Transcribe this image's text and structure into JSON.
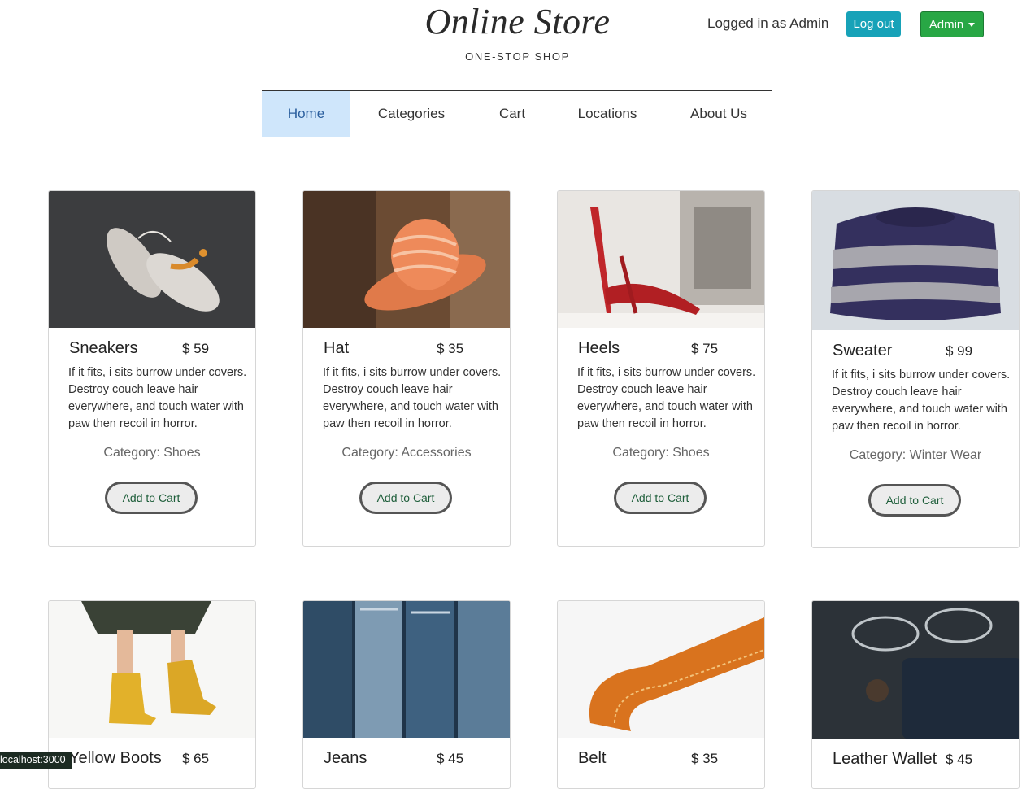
{
  "header": {
    "title": "Online Store",
    "subtitle": "ONE-STOP SHOP",
    "login_text": "Logged in as Admin",
    "logout_label": "Log out",
    "admin_label": "Admin"
  },
  "nav": {
    "items": [
      {
        "label": "Home",
        "active": true
      },
      {
        "label": "Categories"
      },
      {
        "label": "Cart"
      },
      {
        "label": "Locations"
      },
      {
        "label": "About Us"
      }
    ]
  },
  "products": [
    {
      "name": "Sneakers",
      "price": "$ 59",
      "description": "If it fits, i sits burrow under covers. Destroy couch leave hair everywhere, and touch water with paw then recoil in horror.",
      "category": "Category: Shoes",
      "button": "Add to Cart",
      "image": "sneakers-photo"
    },
    {
      "name": "Hat",
      "price": "$ 35",
      "description": "If it fits, i sits burrow under covers. Destroy couch leave hair everywhere, and touch water with paw then recoil in horror.",
      "category": "Category: Accessories",
      "button": "Add to Cart",
      "image": "hat-photo"
    },
    {
      "name": "Heels",
      "price": "$ 75",
      "description": "If it fits, i sits burrow under covers. Destroy couch leave hair everywhere, and touch water with paw then recoil in horror.",
      "category": "Category: Shoes",
      "button": "Add to Cart",
      "image": "heels-photo"
    },
    {
      "name": "Sweater",
      "price": "$ 99",
      "description": "If it fits, i sits burrow under covers. Destroy couch leave hair everywhere, and touch water with paw then recoil in horror.",
      "category": "Category: Winter Wear",
      "button": "Add to Cart",
      "image": "sweater-photo"
    },
    {
      "name": "Yellow Boots",
      "price": "$ 65",
      "image": "boots-photo"
    },
    {
      "name": "Jeans",
      "price": "$ 45",
      "image": "jeans-photo"
    },
    {
      "name": "Belt",
      "price": "$ 35",
      "image": "belt-photo"
    },
    {
      "name": "Leather Wallet",
      "price": "$ 45",
      "image": "wallet-photo"
    }
  ],
  "status_bar": {
    "url": "localhost:3000"
  },
  "colors": {
    "nav_active_bg": "#cfe6fb",
    "logout_btn": "#17a2b8",
    "admin_btn": "#28a745"
  }
}
